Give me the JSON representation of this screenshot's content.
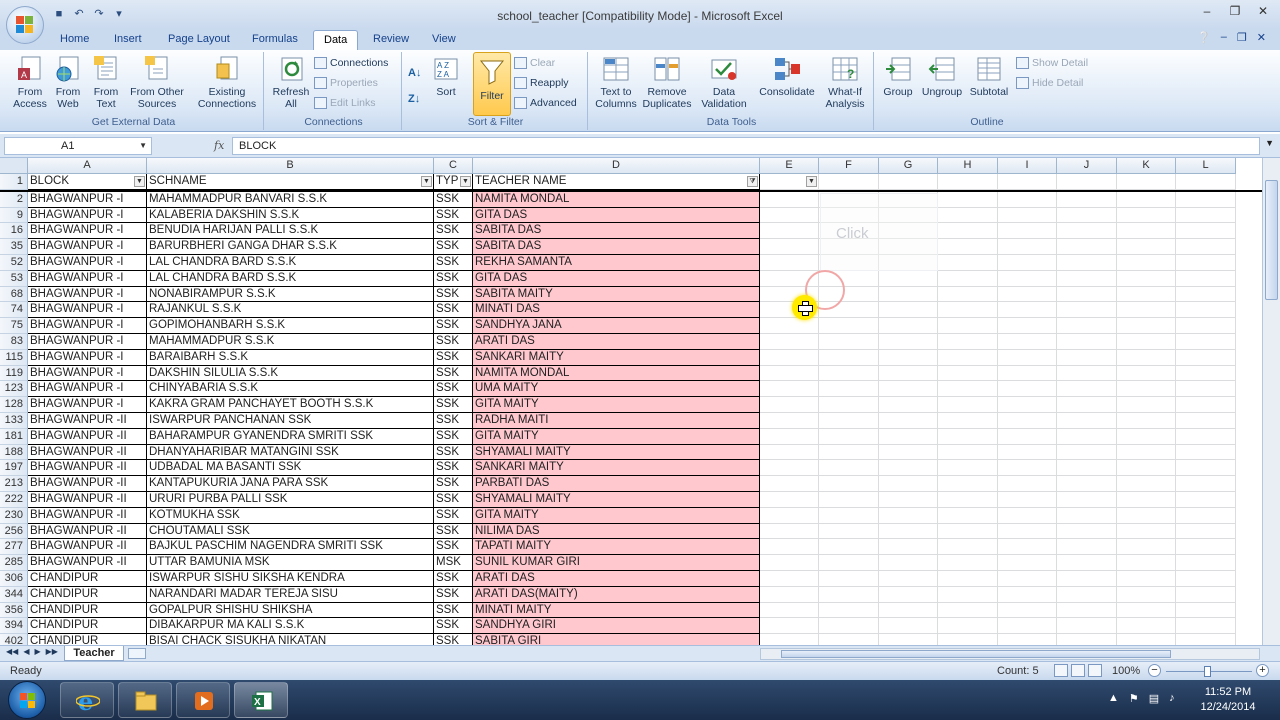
{
  "window": {
    "title": "school_teacher  [Compatibility Mode] - Microsoft Excel",
    "controls": [
      "–",
      "❐",
      "✕"
    ]
  },
  "tabs": [
    "Home",
    "Insert",
    "Page Layout",
    "Formulas",
    "Data",
    "Review",
    "View"
  ],
  "active_tab": "Data",
  "ribbon": {
    "get_external": {
      "label": "Get External Data",
      "from_access": "From\nAccess",
      "from_web": "From\nWeb",
      "from_text": "From\nText",
      "from_other": "From Other\nSources",
      "existing": "Existing\nConnections"
    },
    "connections": {
      "label": "Connections",
      "refresh": "Refresh\nAll",
      "connections": "Connections",
      "properties": "Properties",
      "edit_links": "Edit Links"
    },
    "sort_filter": {
      "label": "Sort & Filter",
      "sort": "Sort",
      "filter": "Filter",
      "clear": "Clear",
      "reapply": "Reapply",
      "advanced": "Advanced"
    },
    "data_tools": {
      "label": "Data Tools",
      "text_to_columns": "Text to\nColumns",
      "remove_duplicates": "Remove\nDuplicates",
      "data_validation": "Data\nValidation",
      "consolidate": "Consolidate",
      "what_if": "What-If\nAnalysis"
    },
    "outline": {
      "label": "Outline",
      "group": "Group",
      "ungroup": "Ungroup",
      "subtotal": "Subtotal",
      "show_detail": "Show Detail",
      "hide_detail": "Hide Detail"
    }
  },
  "formula_bar": {
    "name_box": "A1",
    "fx": "fx",
    "value": "BLOCK"
  },
  "columns": [
    "A",
    "B",
    "C",
    "D",
    "E",
    "F",
    "G",
    "H",
    "I",
    "J",
    "K",
    "L"
  ],
  "header_row": {
    "row_num": "1",
    "cells": [
      "BLOCK",
      "SCHNAME",
      "TYP",
      "TEACHER NAME"
    ]
  },
  "rows": [
    {
      "n": "2",
      "block": "BHAGWANPUR -I",
      "school": "MAHAMMADPUR BANVARI S.S.K",
      "type": "SSK",
      "teacher": "NAMITA MONDAL"
    },
    {
      "n": "9",
      "block": "BHAGWANPUR -I",
      "school": "KALABERIA DAKSHIN S.S.K",
      "type": "SSK",
      "teacher": "GITA DAS"
    },
    {
      "n": "16",
      "block": "BHAGWANPUR -I",
      "school": "BENUDIA HARIJAN PALLI  S.S.K",
      "type": "SSK",
      "teacher": "SABITA DAS"
    },
    {
      "n": "35",
      "block": "BHAGWANPUR -I",
      "school": "BARURBHERI GANGA DHAR S.S.K",
      "type": "SSK",
      "teacher": "SABITA DAS"
    },
    {
      "n": "52",
      "block": "BHAGWANPUR -I",
      "school": "LAL CHANDRA BARD S.S.K",
      "type": "SSK",
      "teacher": "REKHA SAMANTA"
    },
    {
      "n": "53",
      "block": "BHAGWANPUR -I",
      "school": "LAL CHANDRA BARD S.S.K",
      "type": "SSK",
      "teacher": "GITA DAS"
    },
    {
      "n": "68",
      "block": "BHAGWANPUR -I",
      "school": "NONABIRAMPUR S.S.K",
      "type": "SSK",
      "teacher": "SABITA MAITY"
    },
    {
      "n": "74",
      "block": "BHAGWANPUR -I",
      "school": "RAJANKUL S.S.K",
      "type": "SSK",
      "teacher": "MINATI DAS"
    },
    {
      "n": "75",
      "block": "BHAGWANPUR -I",
      "school": "GOPIMOHANBARH S.S.K",
      "type": "SSK",
      "teacher": "SANDHYA JANA"
    },
    {
      "n": "83",
      "block": "BHAGWANPUR -I",
      "school": "MAHAMMADPUR S.S.K",
      "type": "SSK",
      "teacher": "ARATI DAS"
    },
    {
      "n": "115",
      "block": "BHAGWANPUR -I",
      "school": "BARAIBARH S.S.K",
      "type": "SSK",
      "teacher": "SANKARI MAITY"
    },
    {
      "n": "119",
      "block": "BHAGWANPUR -I",
      "school": "DAKSHIN SILULIA S.S.K",
      "type": "SSK",
      "teacher": "NAMITA MONDAL"
    },
    {
      "n": "123",
      "block": "BHAGWANPUR -I",
      "school": "CHINYABARIA S.S.K",
      "type": "SSK",
      "teacher": "UMA MAITY"
    },
    {
      "n": "128",
      "block": "BHAGWANPUR -I",
      "school": "KAKRA GRAM PANCHAYET BOOTH S.S.K",
      "type": "SSK",
      "teacher": "GITA MAITY"
    },
    {
      "n": "133",
      "block": "BHAGWANPUR -II",
      "school": "ISWARPUR PANCHANAN SSK",
      "type": "SSK",
      "teacher": "RADHA MAITI"
    },
    {
      "n": "181",
      "block": "BHAGWANPUR -II",
      "school": "BAHARAMPUR GYANENDRA  SMRITI SSK",
      "type": "SSK",
      "teacher": "GITA MAITY"
    },
    {
      "n": "188",
      "block": "BHAGWANPUR -II",
      "school": "DHANYAHARIBAR MATANGINI SSK",
      "type": "SSK",
      "teacher": "SHYAMALI MAITY"
    },
    {
      "n": "197",
      "block": "BHAGWANPUR -II",
      "school": "UDBADAL MA BASANTI SSK",
      "type": "SSK",
      "teacher": "SANKARI MAITY"
    },
    {
      "n": "213",
      "block": "BHAGWANPUR -II",
      "school": "KANTAPUKURIA JANA PARA SSK",
      "type": "SSK",
      "teacher": "PARBATI DAS"
    },
    {
      "n": "222",
      "block": "BHAGWANPUR -II",
      "school": "URURI PURBA PALLI SSK",
      "type": "SSK",
      "teacher": "SHYAMALI MAITY"
    },
    {
      "n": "230",
      "block": "BHAGWANPUR -II",
      "school": "KOTMUKHA SSK",
      "type": "SSK",
      "teacher": "GITA MAITY"
    },
    {
      "n": "256",
      "block": "BHAGWANPUR -II",
      "school": "CHOUTAMALI SSK",
      "type": "SSK",
      "teacher": "NILIMA DAS"
    },
    {
      "n": "277",
      "block": "BHAGWANPUR -II",
      "school": "BAJKUL PASCHIM NAGENDRA SMRITI SSK",
      "type": "SSK",
      "teacher": "TAPATI MAITY"
    },
    {
      "n": "285",
      "block": "BHAGWANPUR -II",
      "school": "UTTAR BAMUNIA MSK",
      "type": "MSK",
      "teacher": "SUNIL KUMAR GIRI"
    },
    {
      "n": "306",
      "block": "CHANDIPUR",
      "school": "ISWARPUR SISHU SIKSHA KENDRA",
      "type": "SSK",
      "teacher": "ARATI DAS"
    },
    {
      "n": "344",
      "block": "CHANDIPUR",
      "school": "NARANDARI MADAR TEREJA SISU",
      "type": "SSK",
      "teacher": "ARATI DAS(MAITY)"
    },
    {
      "n": "356",
      "block": "CHANDIPUR",
      "school": "GOPALPUR SHISHU SHIKSHA",
      "type": "SSK",
      "teacher": "MINATI MAITY"
    },
    {
      "n": "394",
      "block": "CHANDIPUR",
      "school": "DIBAKARPUR MA KALI S.S.K",
      "type": "SSK",
      "teacher": "SANDHYA GIRI"
    },
    {
      "n": "402",
      "block": "CHANDIPUR",
      "school": "BISAI CHACK  SISUKHA NIKATAN",
      "type": "SSK",
      "teacher": "SABITA GIRI"
    }
  ],
  "overlay": {
    "click_text": "Click"
  },
  "sheet_tab": "Teacher",
  "status": {
    "ready": "Ready",
    "count": "Count: 5",
    "zoom": "100%"
  },
  "taskbar": {
    "time": "11:52 PM",
    "date": "12/24/2014"
  }
}
